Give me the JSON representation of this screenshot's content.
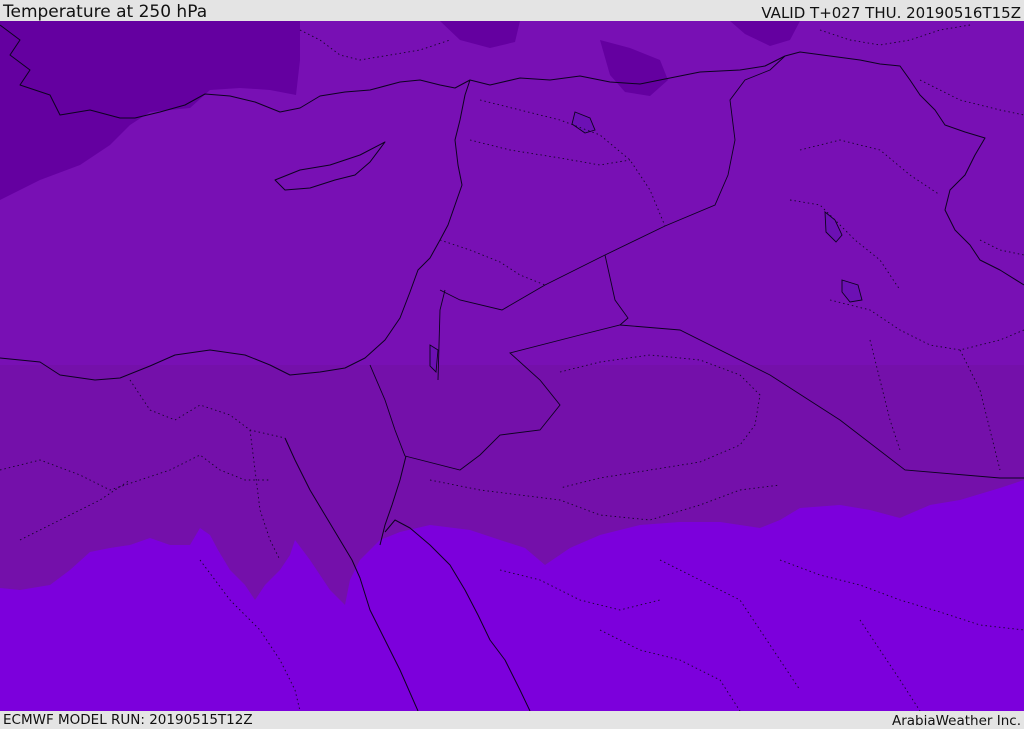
{
  "header": {
    "title": "Temperature at 250 hPa",
    "valid_time": "VALID T+027 THU. 20190516T15Z"
  },
  "footer": {
    "model_run": "ECMWF MODEL RUN: 20190515T12Z",
    "credit": "ArabiaWeather Inc."
  },
  "map": {
    "variable": "Temperature",
    "level": "250 hPa",
    "fill_colors": {
      "coldest": "#6400a0",
      "cold": "#7810b4",
      "cool": "#7410aa",
      "warm": "#7c00dc"
    }
  }
}
